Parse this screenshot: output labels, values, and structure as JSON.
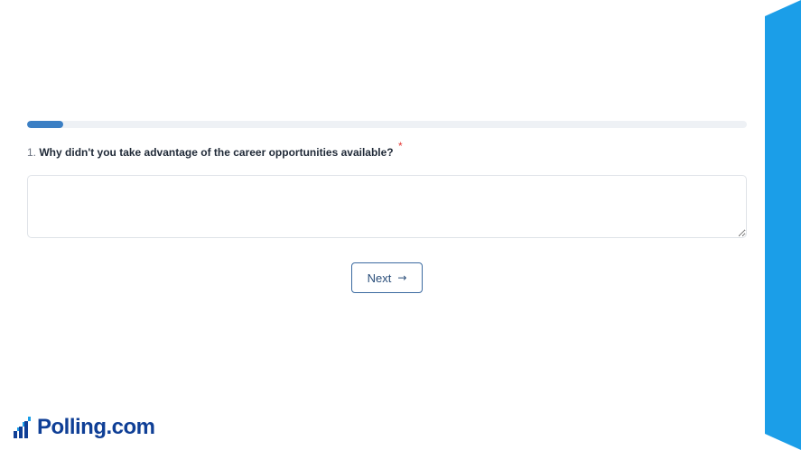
{
  "colors": {
    "accent": "#1b9ee8",
    "progress_fill": "#3b7fc4",
    "required": "#e53935",
    "brand_text": "#0f3f96"
  },
  "progress": {
    "fraction": 0.05
  },
  "question": {
    "number": "1.",
    "text": "Why didn't you take advantage of the career opportunities available?",
    "required_marker": "*"
  },
  "answer": {
    "value": "",
    "placeholder": ""
  },
  "navigation": {
    "next_label": "Next",
    "next_icon": "arrow-right-icon",
    "next_glyph": "→"
  },
  "brand": {
    "name": "Polling.com",
    "icon": "stairs-chart-icon"
  }
}
